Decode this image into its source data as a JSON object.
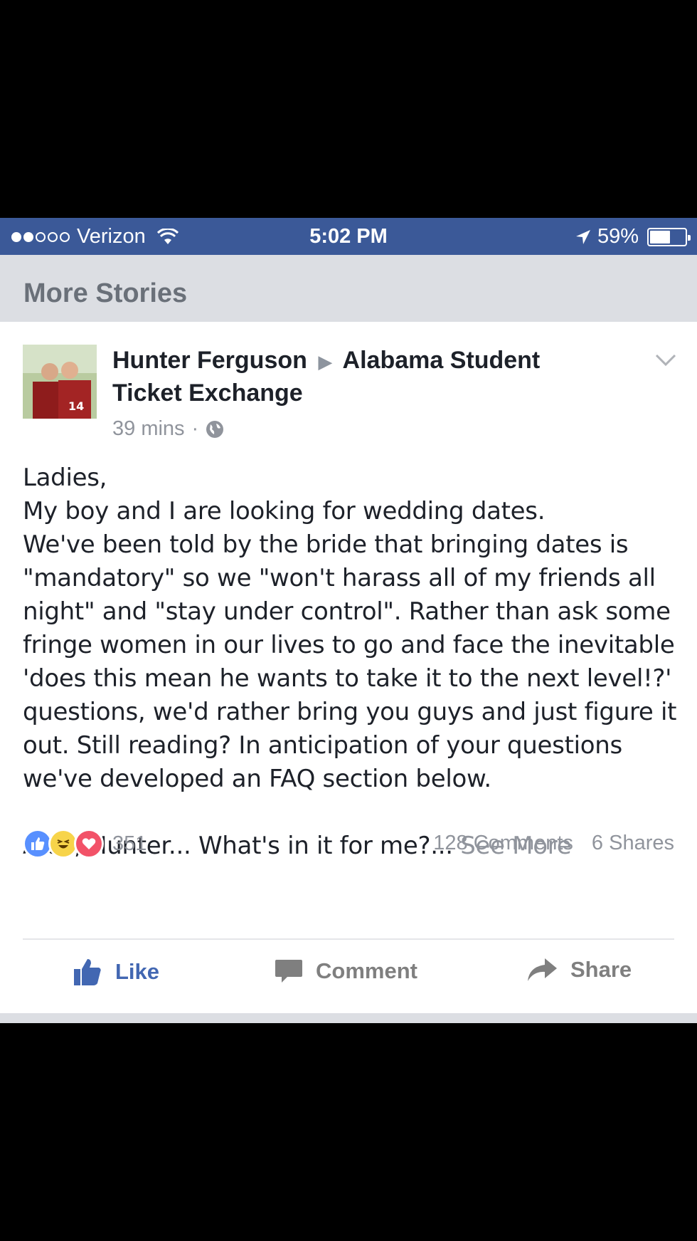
{
  "status_bar": {
    "carrier": "Verizon",
    "time": "5:02 PM",
    "battery_percent": "59%",
    "battery_level": 0.59,
    "signal_filled": 2,
    "signal_total": 5
  },
  "section": {
    "title": "More Stories"
  },
  "post": {
    "author": "Hunter Ferguson",
    "arrow": "▶",
    "group": "Alabama Student Ticket Exchange",
    "time": "39 mins",
    "separator": "·",
    "body": "Ladies,\nMy boy and I are looking for wedding dates.\nWe've been told by the bride that bringing dates is \"mandatory\" so we \"won't harass all of my friends all night\" and \"stay under control\". Rather than ask some fringe women in our lives to go and face the inevitable 'does this mean he wants to take it to the next level!?' questions, we'd rather bring you guys and just figure it out. Still reading? In anticipation of your questions we've developed an FAQ section below.",
    "teaser": "Alex, Hunter... What's in it for me?...",
    "see_more": "See More",
    "reaction_count": "351",
    "comments": "128 Comments",
    "shares": "6 Shares"
  },
  "actions": {
    "like": "Like",
    "comment": "Comment",
    "share": "Share"
  },
  "colors": {
    "status_bar": "#3b5998",
    "like_blue": "#4267b2",
    "section_bg": "#dcdee3"
  }
}
